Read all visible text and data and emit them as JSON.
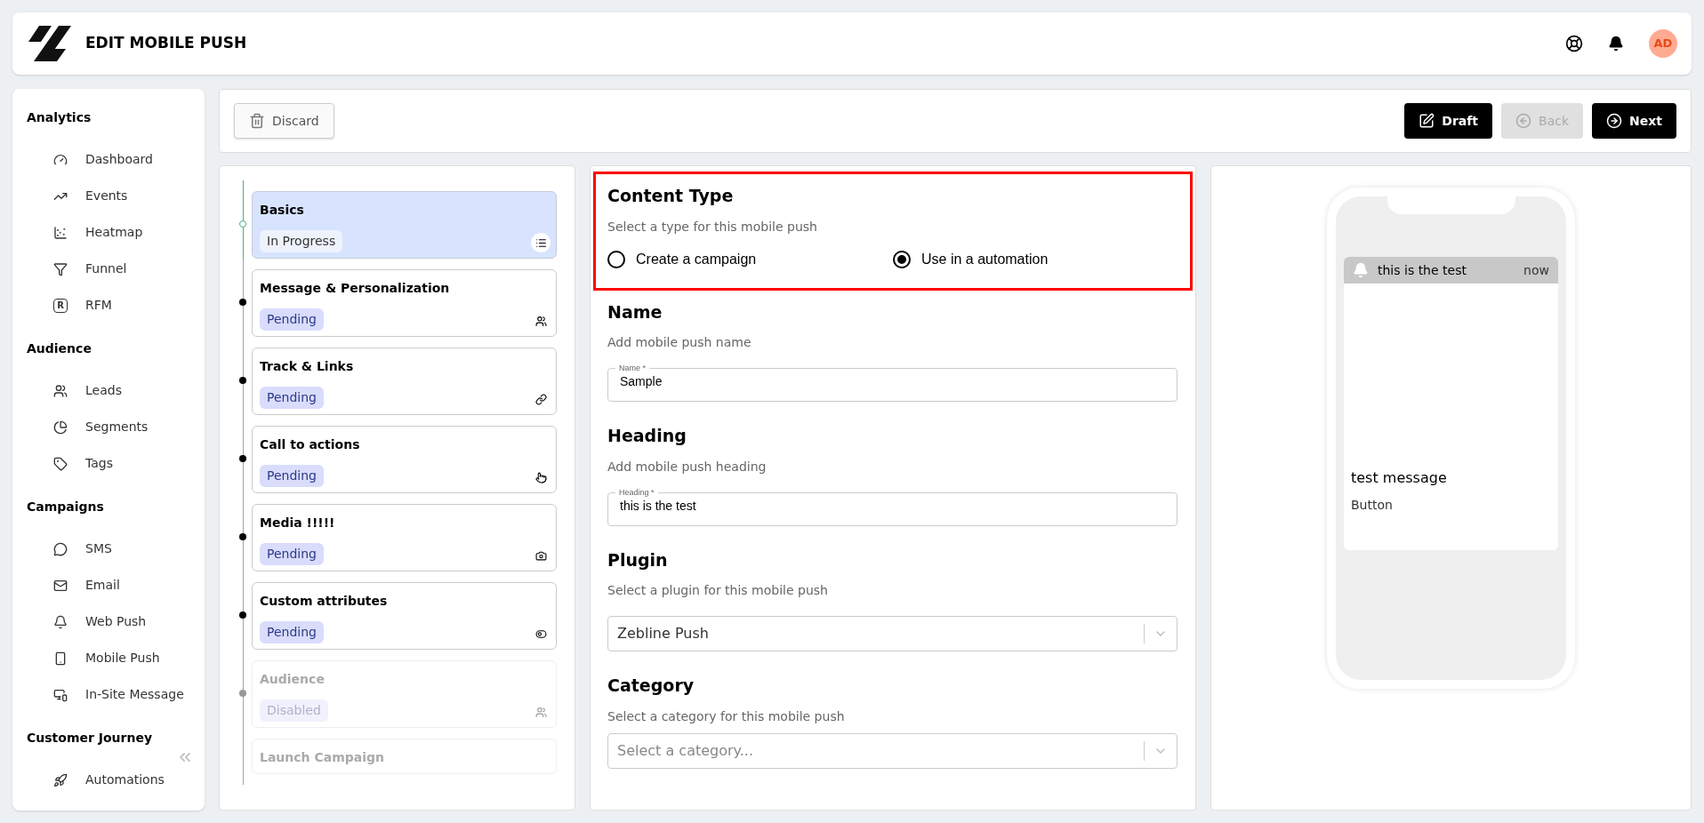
{
  "header": {
    "title": "EDIT MOBILE PUSH",
    "avatar": "AD"
  },
  "sidebar": {
    "sections": [
      {
        "title": "Analytics",
        "items": [
          {
            "label": "Dashboard"
          },
          {
            "label": "Events"
          },
          {
            "label": "Heatmap"
          },
          {
            "label": "Funnel"
          },
          {
            "label": "RFM",
            "icon_letter": "R"
          }
        ]
      },
      {
        "title": "Audience",
        "items": [
          {
            "label": "Leads"
          },
          {
            "label": "Segments"
          },
          {
            "label": "Tags"
          }
        ]
      },
      {
        "title": "Campaigns",
        "items": [
          {
            "label": "SMS"
          },
          {
            "label": "Email"
          },
          {
            "label": "Web Push"
          },
          {
            "label": "Mobile Push"
          },
          {
            "label": "In-Site Message"
          }
        ]
      },
      {
        "title": "Customer Journey",
        "items": [
          {
            "label": "Automations"
          }
        ]
      }
    ]
  },
  "toolbar": {
    "discard": "Discard",
    "buttons": [
      {
        "label": "Draft",
        "disabled": false
      },
      {
        "label": "Back",
        "disabled": true
      },
      {
        "label": "Next",
        "disabled": false
      }
    ]
  },
  "steps": [
    {
      "title": "Basics",
      "status": "In Progress",
      "kind": "in_progress",
      "selected": true
    },
    {
      "title": "Message & Personalization",
      "status": "Pending",
      "kind": "pending",
      "selected": false
    },
    {
      "title": "Track & Links",
      "status": "Pending",
      "kind": "pending",
      "selected": false
    },
    {
      "title": "Call to actions",
      "status": "Pending",
      "kind": "pending",
      "selected": false
    },
    {
      "title": "Media !!!!!",
      "status": "Pending",
      "kind": "pending",
      "selected": false
    },
    {
      "title": "Custom attributes",
      "status": "Pending",
      "kind": "pending",
      "selected": false
    },
    {
      "title": "Audience",
      "status": "Disabled",
      "kind": "disabled",
      "selected": false
    },
    {
      "title": "Launch Campaign",
      "kind": "disabled",
      "selected": false
    }
  ],
  "form": {
    "content_type": {
      "title": "Content Type",
      "description": "Select a type for this mobile push",
      "options": [
        {
          "label": "Create a campaign",
          "selected": false
        },
        {
          "label": "Use in a automation",
          "selected": true
        }
      ]
    },
    "name": {
      "title": "Name",
      "description": "Add mobile push name",
      "label": "Name *",
      "value": "Sample"
    },
    "heading": {
      "title": "Heading",
      "description": "Add mobile push heading",
      "label": "Heading *",
      "value": "this is the test"
    },
    "plugin": {
      "title": "Plugin",
      "description": "Select a plugin for this mobile push",
      "value": "Zebline Push"
    },
    "category": {
      "title": "Category",
      "description": "Select a category for this mobile push",
      "placeholder": "Select a category..."
    }
  },
  "preview": {
    "notification_title": "this is the test",
    "time": "now",
    "message": "test message",
    "button": "Button"
  }
}
